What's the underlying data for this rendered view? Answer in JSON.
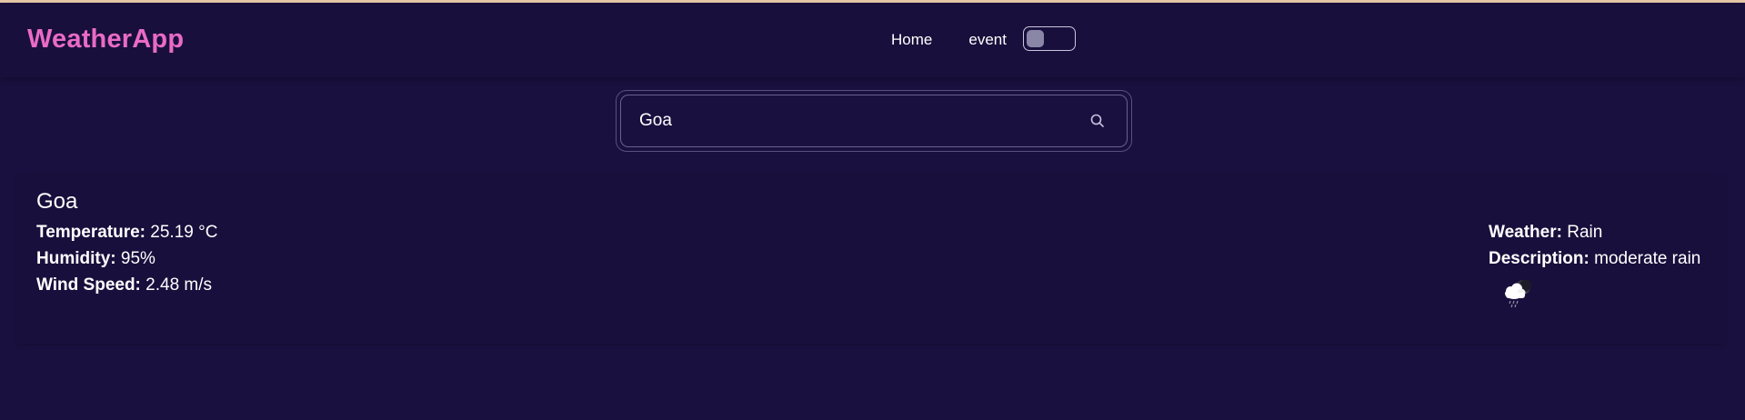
{
  "app": {
    "brand": "WeatherApp"
  },
  "nav": {
    "items": [
      {
        "label": "Home"
      },
      {
        "label": "event"
      }
    ],
    "toggle_on": false
  },
  "search": {
    "value": "Goa",
    "placeholder": "",
    "icon": "search-icon"
  },
  "weather": {
    "city": "Goa",
    "temperature_label": "Temperature:",
    "temperature_value": "25.19 °C",
    "humidity_label": "Humidity:",
    "humidity_value": "95%",
    "wind_label": "Wind Speed:",
    "wind_value": "2.48 m/s",
    "condition_label": "Weather:",
    "condition_value": "Rain",
    "description_label": "Description:",
    "description_value": "moderate rain",
    "icon": "rain-cloud-moon-icon"
  },
  "colors": {
    "background": "#1a1040",
    "brand": "#e96bc6",
    "text": "#ffffff"
  }
}
